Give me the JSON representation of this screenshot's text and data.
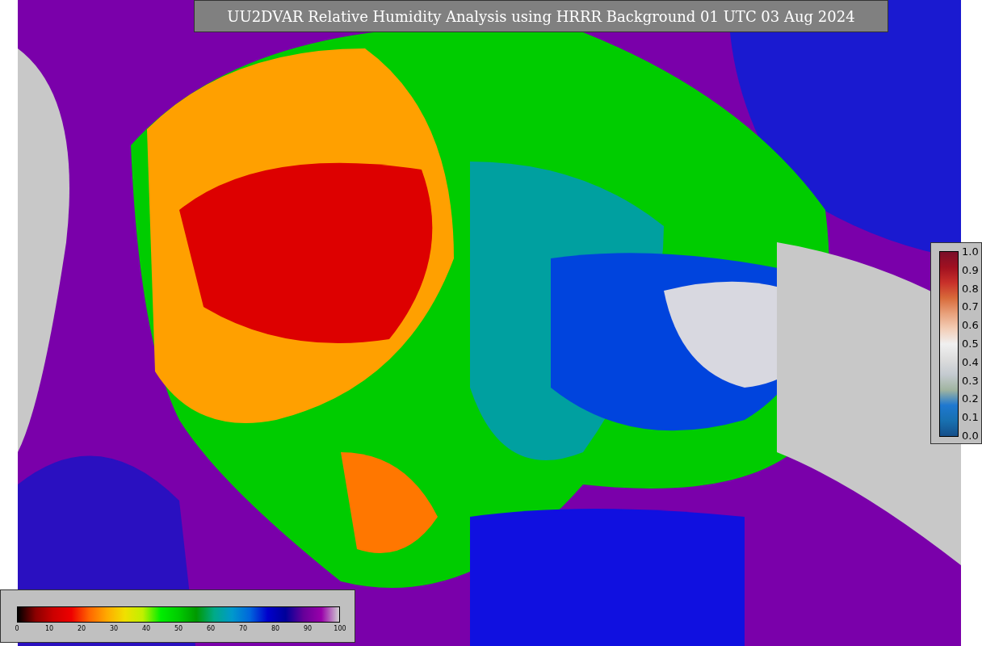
{
  "title": "UU2DVAR Relative Humidity Analysis using HRRR Background 01 UTC 03 Aug 2024",
  "humidity_scale": {
    "ticks": [
      "0",
      "10",
      "20",
      "30",
      "40",
      "50",
      "60",
      "70",
      "80",
      "90",
      "100"
    ]
  },
  "weight_scale": {
    "ticks": [
      "1.0",
      "0.9",
      "0.8",
      "0.7",
      "0.6",
      "0.5",
      "0.4",
      "0.3",
      "0.2",
      "0.1",
      "0.0"
    ]
  }
}
